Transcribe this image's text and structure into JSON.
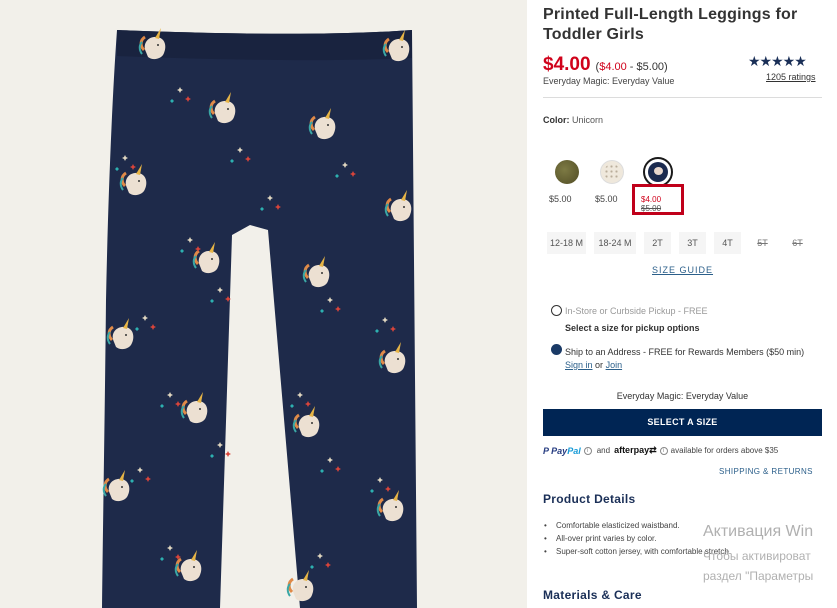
{
  "product": {
    "title": "Printed Full-Length Leggings for Toddler Girls",
    "price_now": "$4.00",
    "price_range_open": "(",
    "price_range_low": "$4.00",
    "price_range_rest": " - $5.00)",
    "magic_label": "Everyday Magic: Everyday Value",
    "stars": "★★★★★",
    "rating_value": 5,
    "ratings_count": "1205 ratings"
  },
  "color": {
    "label": "Color:",
    "value": "Unicorn",
    "swatches": [
      {
        "name": "olive",
        "price": "$5.00",
        "color": "#6b6838"
      },
      {
        "name": "dots",
        "price": "$5.00",
        "color": "#efe8dc"
      },
      {
        "name": "unicorn",
        "price_now": "$4.00",
        "price_was": "$5.00",
        "color": "#1b2a4e",
        "selected": true
      }
    ]
  },
  "sizes": [
    {
      "label": "12-18 M",
      "available": true
    },
    {
      "label": "18-24 M",
      "available": true
    },
    {
      "label": "2T",
      "available": true
    },
    {
      "label": "3T",
      "available": true
    },
    {
      "label": "4T",
      "available": true
    },
    {
      "label": "5T",
      "available": false
    },
    {
      "label": "6T",
      "available": false
    }
  ],
  "size_guide": "SIZE GUIDE",
  "fulfillment": {
    "pickup_label": "In-Store or Curbside Pickup - FREE",
    "pickup_sub": "Select a size for pickup options",
    "ship_label": "Ship to an Address - FREE for Rewards Members ($50 min)",
    "sign_in": "Sign in",
    "or": "or",
    "join": "Join",
    "magic_label": "Everyday Magic: Everyday Value"
  },
  "select_size_button": "SELECT A SIZE",
  "payment": {
    "paypal_a": "Pay",
    "paypal_b": "Pal",
    "and": "and",
    "afterpay": "afterpay",
    "available_text": "available for orders above $35"
  },
  "shipping_returns": "SHIPPING & RETURNS",
  "details": {
    "heading": "Product Details",
    "bullets": [
      "Comfortable elasticized waistband.",
      "All-over print varies by color.",
      "Super-soft cotton jersey, with comfortable stretch."
    ]
  },
  "materials_heading": "Materials & Care",
  "watermark": {
    "line1": "Активация Win",
    "line2": "Чтобы активироват",
    "line3": "раздел \"Параметры"
  },
  "colors": {
    "sale_red": "#d0021b",
    "navy_button": "#002554",
    "link_blue": "#2b5f8a",
    "legging_navy": "#1e2a4a",
    "image_bg": "#f2f0ea"
  }
}
